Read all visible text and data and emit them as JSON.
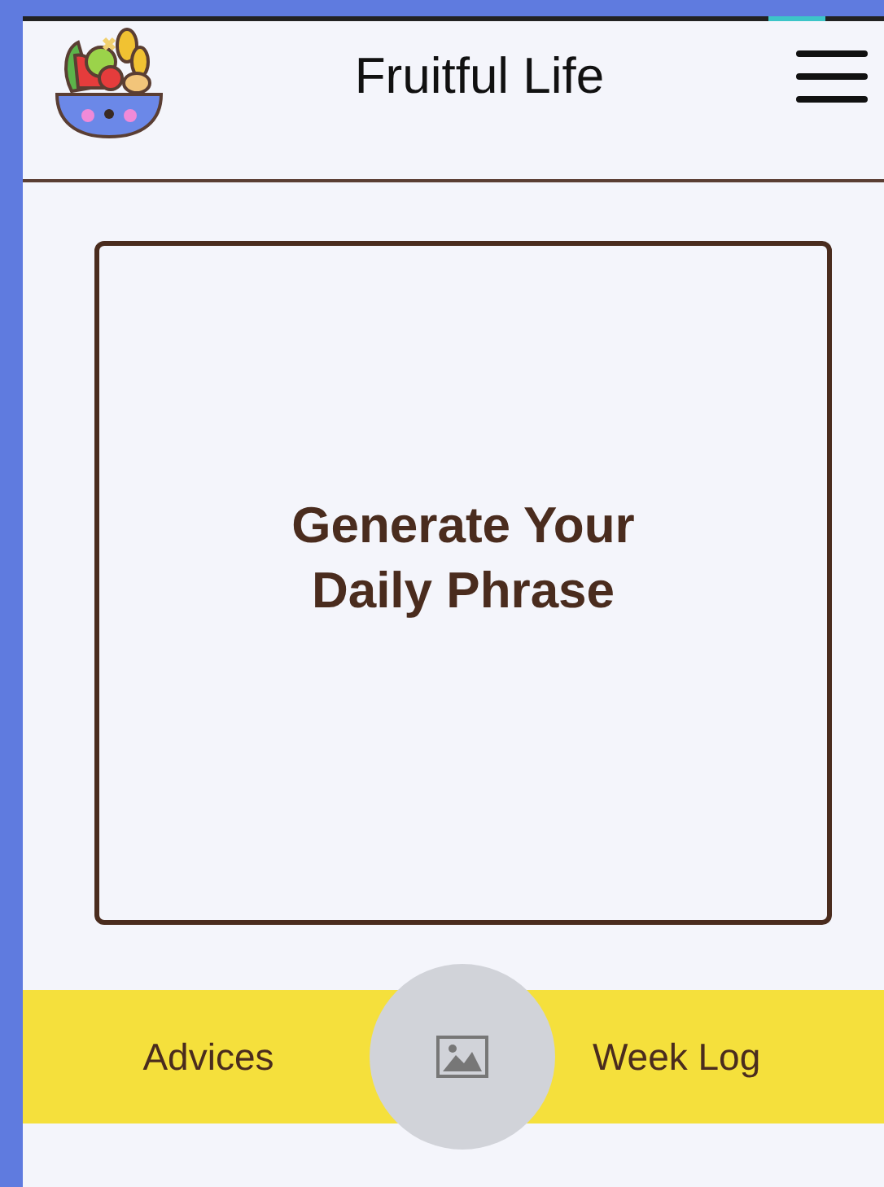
{
  "header": {
    "title": "Fruitful Life"
  },
  "card": {
    "text": "Generate Your Daily Phrase"
  },
  "bottom_nav": {
    "items": [
      {
        "label": "Advices",
        "kind": "link"
      },
      {
        "kind": "image"
      },
      {
        "label": "Week Log",
        "kind": "link"
      }
    ]
  }
}
